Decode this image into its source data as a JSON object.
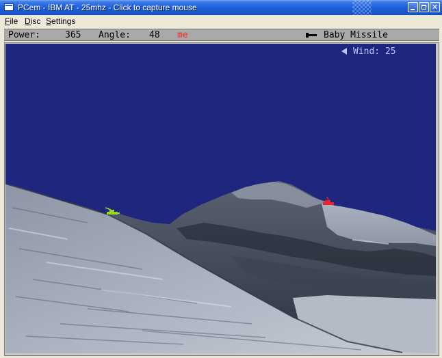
{
  "window": {
    "title": "PCem - IBM AT - 25mhz - Click to capture mouse"
  },
  "menu": {
    "file": {
      "accel": "F",
      "rest": "ile"
    },
    "disc": {
      "accel": "D",
      "rest": "isc"
    },
    "settings": {
      "accel": "S",
      "rest": "ettings"
    }
  },
  "game": {
    "power_label": "Power:",
    "power_value": "365",
    "angle_label": "Angle:",
    "angle_value": "48",
    "player_name": "me",
    "weapon_icon": "missile-icon",
    "weapon_name": "Baby Missile",
    "wind_label": "Wind:",
    "wind_value": "25",
    "wind_direction": "left",
    "colors": {
      "sky": "#1f267d",
      "player_name": "#ff2a2a",
      "tank_green": "#9ad62a",
      "tank_red": "#e8242a",
      "wind_text": "#b8c6ff"
    }
  }
}
